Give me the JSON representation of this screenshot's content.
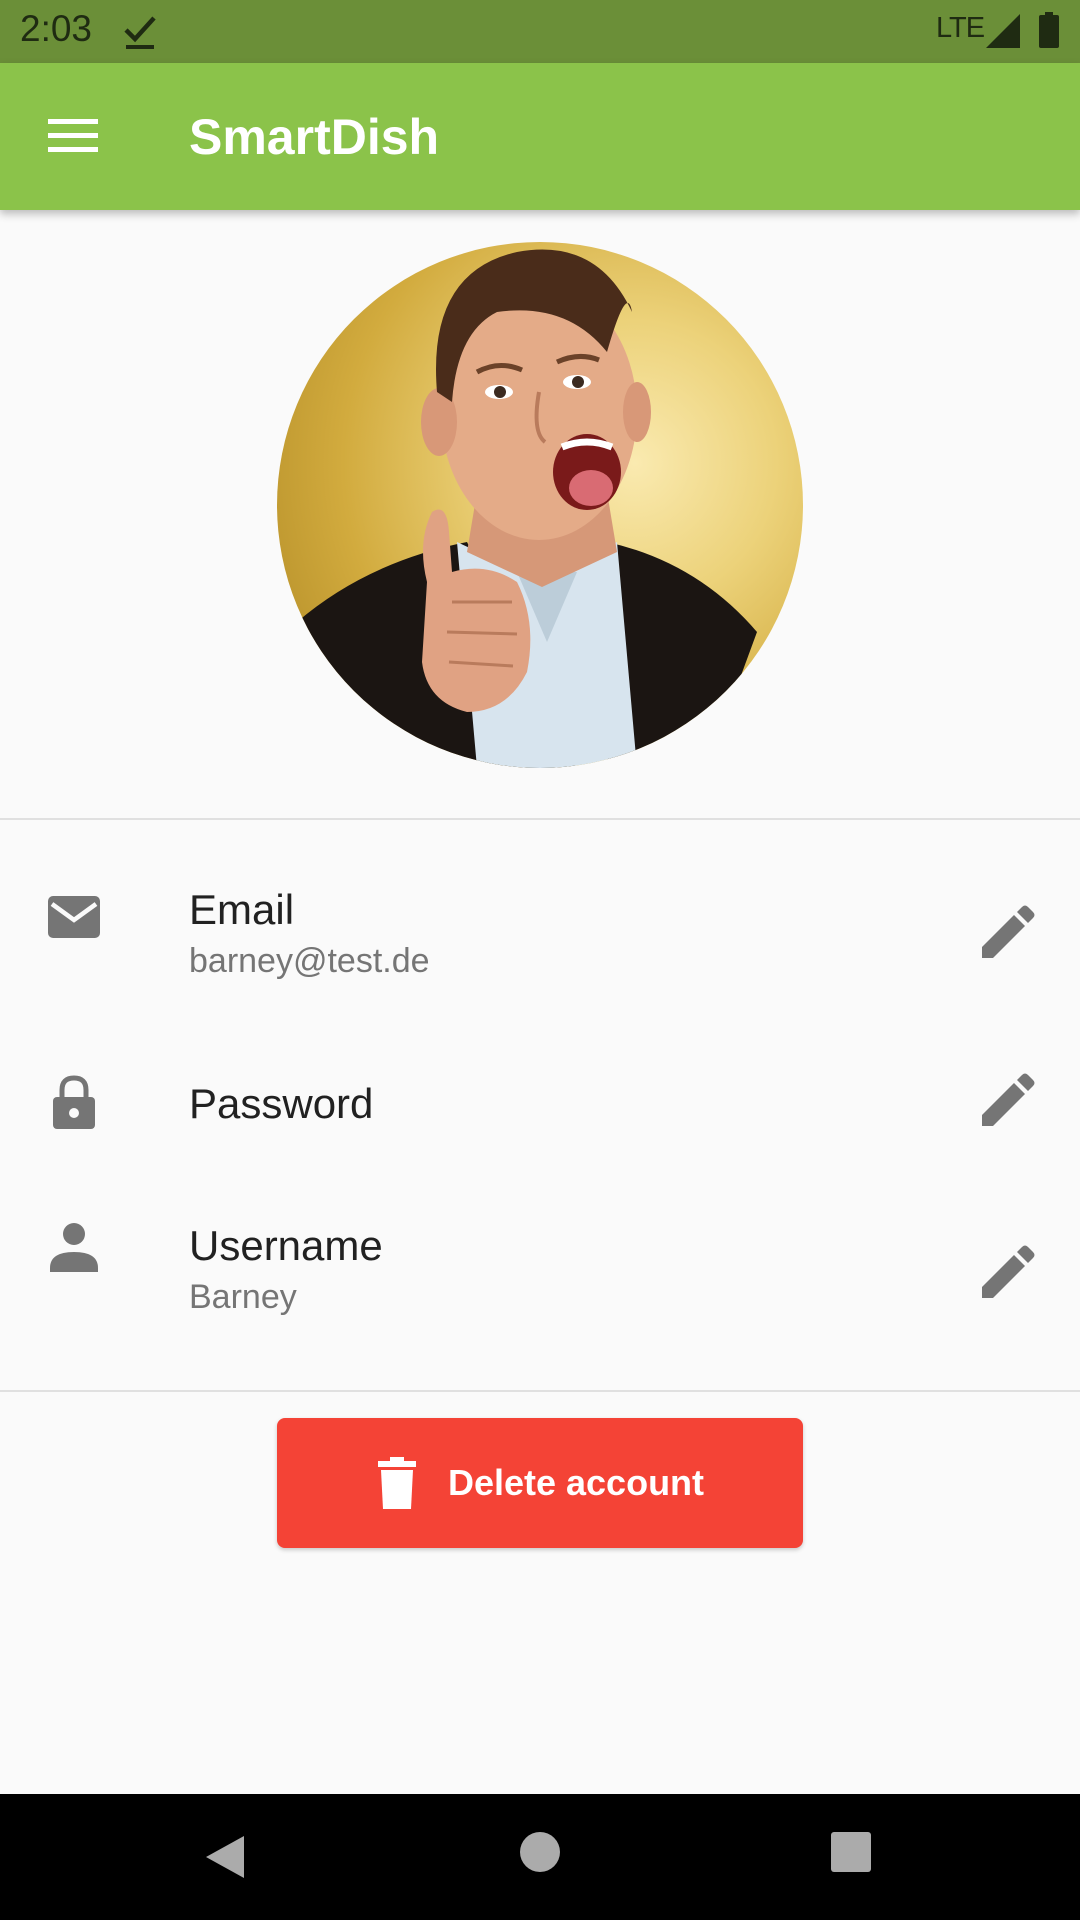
{
  "status_bar": {
    "time": "2:03",
    "network": "LTE",
    "icons": [
      "download-done-icon",
      "signal-icon",
      "battery-icon"
    ]
  },
  "app_bar": {
    "title": "SmartDish",
    "menu_icon": "menu-icon",
    "background": "#8bc34a"
  },
  "profile": {
    "avatar": "profile-photo"
  },
  "fields": [
    {
      "icon": "email-icon",
      "title": "Email",
      "value": "barney@test.de",
      "action_icon": "edit-icon"
    },
    {
      "icon": "lock-icon",
      "title": "Password",
      "value": "",
      "action_icon": "edit-icon"
    },
    {
      "icon": "person-icon",
      "title": "Username",
      "value": "Barney",
      "action_icon": "edit-icon"
    }
  ],
  "delete_button": {
    "label": "Delete account",
    "icon": "trash-icon",
    "background": "#f44336"
  },
  "nav_bar": {
    "icons": [
      "back-icon",
      "home-icon",
      "recent-apps-icon"
    ]
  }
}
